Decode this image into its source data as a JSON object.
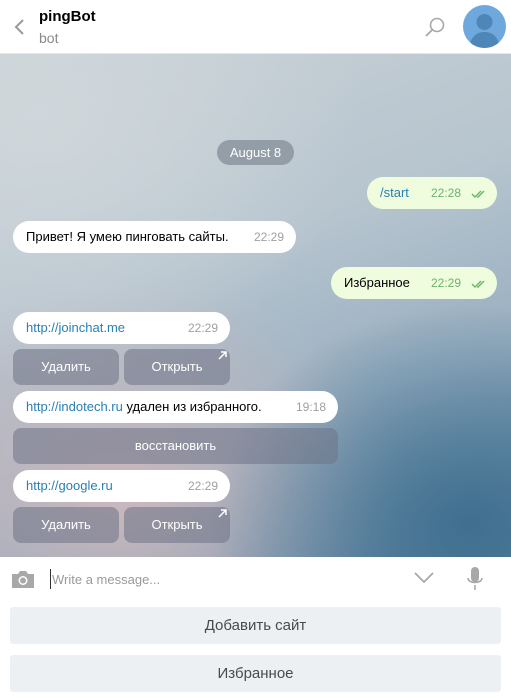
{
  "header": {
    "title": "pingBot",
    "subtitle": "bot"
  },
  "chat": {
    "date": "August 8",
    "messages": [
      {
        "text": "/start",
        "time": "22:28"
      },
      {
        "text": "Привет! Я умею пинговать сайты.",
        "time": "22:29"
      },
      {
        "text": "Избранное",
        "time": "22:29"
      },
      {
        "link": "http://joinchat.me",
        "time": "22:29",
        "buttons": [
          "Удалить",
          "Открыть"
        ]
      },
      {
        "link": "http://indotech.ru",
        "text": " удален из избранного.",
        "time": "19:18",
        "buttons": [
          "восстановить"
        ]
      },
      {
        "link": "http://google.ru",
        "time": "22:29",
        "buttons": [
          "Удалить",
          "Открыть"
        ]
      }
    ]
  },
  "input": {
    "placeholder": "Write a message..."
  },
  "keyboard": {
    "buttons": [
      "Добавить сайт",
      "Избранное"
    ]
  },
  "colors": {
    "accent_link": "#2a7fb3",
    "outgoing_bubble": "#effdde",
    "read_check": "#6cb36c"
  }
}
